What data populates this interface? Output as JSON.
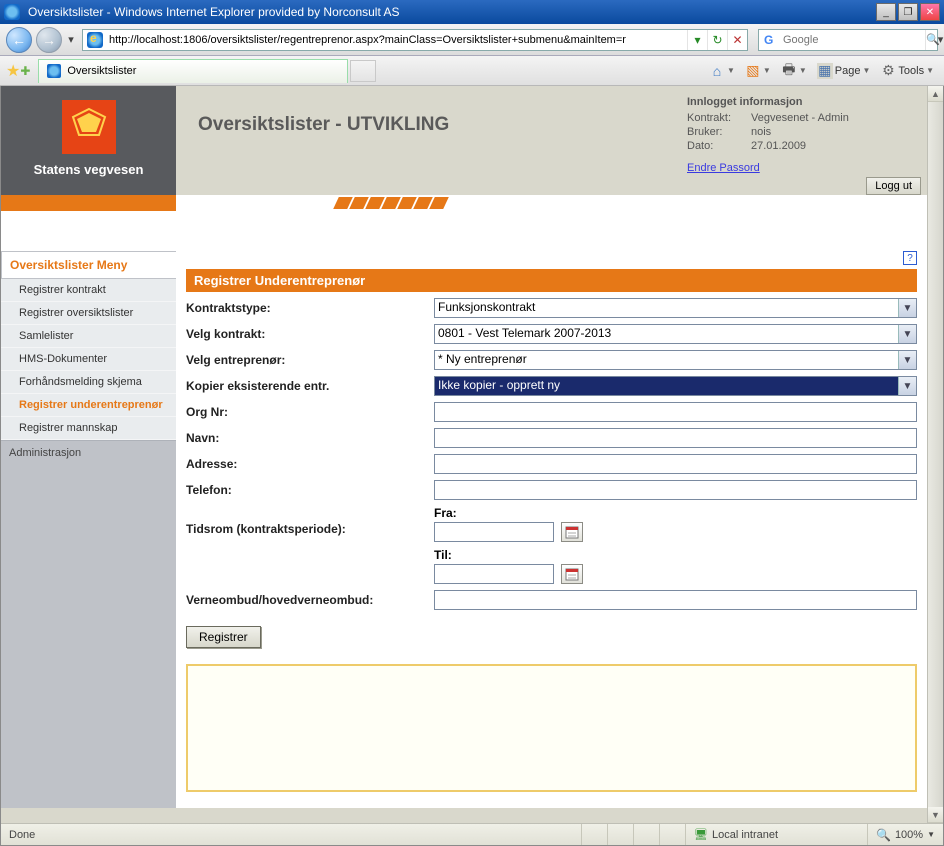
{
  "window": {
    "title": "Oversiktslister - Windows Internet Explorer provided by Norconsult AS",
    "min": "_",
    "rest": "❐",
    "close": "✕"
  },
  "nav": {
    "back": "←",
    "fwd": "→",
    "url": "http://localhost:1806/oversiktslister/regentreprenor.aspx?mainClass=Oversiktslister+submenu&mainItem=r",
    "reload": "↻",
    "stop": "✕",
    "search_placeholder": "Google",
    "search_icon": "G",
    "mag": "🔍"
  },
  "linkbar": {
    "tab_title": "Oversiktslister",
    "tools": {
      "home": "⌂",
      "rss": "ℕ",
      "print": "🖶",
      "page_label": "Page",
      "tools_label": "Tools"
    }
  },
  "header": {
    "brand": "Statens vegvesen",
    "page_title": "Oversiktslister - UTVIKLING",
    "info_title": "Innlogget informasjon",
    "kontrakt_k": "Kontrakt:",
    "kontrakt_v": "Vegvesenet - Admin",
    "bruker_k": "Bruker:",
    "bruker_v": "nois",
    "dato_k": "Dato:",
    "dato_v": "27.01.2009",
    "change_pwd": "Endre Passord",
    "logout": "Logg ut"
  },
  "menu": {
    "header": "Oversiktslister Meny",
    "items": [
      "Registrer kontrakt",
      "Registrer oversiktslister",
      "Samlelister",
      "HMS-Dokumenter",
      "Forhåndsmelding skjema",
      "Registrer underentreprenør",
      "Registrer mannskap"
    ],
    "section": "Administrasjon"
  },
  "form": {
    "title": "Registrer Underentreprenør",
    "labels": {
      "kontraktstype": "Kontraktstype:",
      "velg_kontrakt": "Velg kontrakt:",
      "velg_entr": "Velg entreprenør:",
      "kopier": "Kopier eksisterende entr.",
      "orgnr": "Org Nr:",
      "navn": "Navn:",
      "adresse": "Adresse:",
      "telefon": "Telefon:",
      "tidsrom": "Tidsrom (kontraktsperiode):",
      "fra": "Fra:",
      "til": "Til:",
      "verneombud": "Verneombud/hovedverneombud:"
    },
    "values": {
      "kontraktstype": "Funksjonskontrakt",
      "velg_kontrakt": "0801 - Vest Telemark 2007-2013",
      "velg_entr": "* Ny entreprenør",
      "kopier": "Ikke kopier - opprett ny",
      "orgnr": "",
      "navn": "",
      "adresse": "",
      "telefon": "",
      "fra": "",
      "til": "",
      "verneombud": ""
    },
    "submit": "Registrer",
    "help": "?"
  },
  "status": {
    "done": "Done",
    "zone": "Local intranet",
    "zoom": "100%"
  }
}
